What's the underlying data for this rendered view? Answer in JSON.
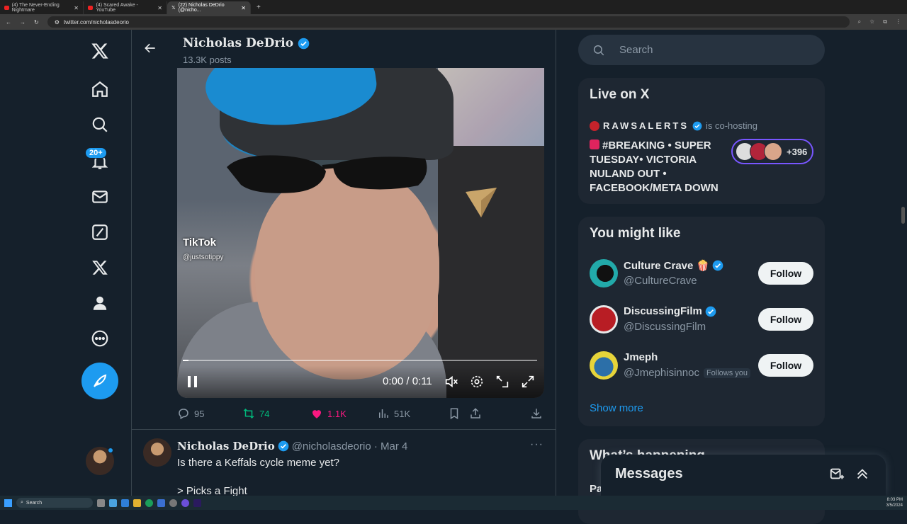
{
  "browser": {
    "tabs": [
      {
        "label": "(4) The Never-Ending Nightmare"
      },
      {
        "label": "(4) Scared Awake - YouTube"
      },
      {
        "label": "(22) Nicholas DeDrio (@nicho..."
      }
    ],
    "url": "twitter.com/nicholasdeorio"
  },
  "nav": {
    "notifications_badge": "20+"
  },
  "header": {
    "name": "Nicholas DeDrio",
    "posts": "13.3K posts"
  },
  "video": {
    "tiktok_label": "TikTok",
    "tiktok_handle": "@justsotippy",
    "time": "0:00 / 0:11",
    "progress": 0.015
  },
  "actions": {
    "replies": "95",
    "reposts": "74",
    "likes": "1.1K",
    "views": "51K"
  },
  "tweet2": {
    "name": "Nicholas DeDrio",
    "meta": "@nicholasdeorio · Mar 4",
    "text": "Is there a Keffals cycle meme yet?\n\n> Picks a Fight"
  },
  "right": {
    "search_placeholder": "Search",
    "live": {
      "title": "Live on X",
      "host": "RAWSALERTS",
      "cohosting": "is co-hosting",
      "space_title": "#BREAKING • SUPER TUESDAY• VICTORIA NULAND OUT • FACEBOOK/META DOWN",
      "listeners": "+396"
    },
    "might_like": {
      "title": "You might like",
      "users": [
        {
          "name": "Culture Crave 🍿",
          "handle": "@CultureCrave",
          "follows_you": ""
        },
        {
          "name": "DiscussingFilm",
          "handle": "@DiscussingFilm",
          "follows_you": ""
        },
        {
          "name": "Jmeph",
          "handle": "@Jmephisinnoc",
          "follows_you": "Follows you"
        }
      ],
      "follow_label": "Follow",
      "show_more": "Show more"
    },
    "whats_happening": "What’s happening",
    "whats_item": "Pa"
  },
  "messages": {
    "title": "Messages"
  },
  "taskbar": {
    "search": "Search",
    "time": "8:03 PM",
    "date": "3/5/2024"
  },
  "colors": {
    "accent": "#1d9bf0",
    "background": "#15202b",
    "like": "#f91880",
    "repost": "#00ba7c"
  }
}
